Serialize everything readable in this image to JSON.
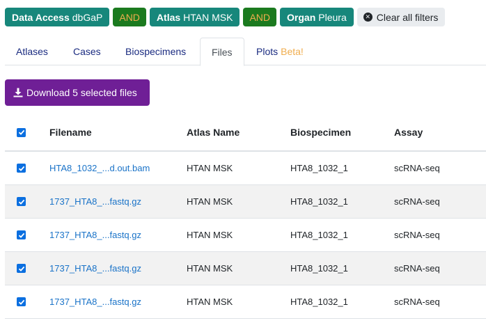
{
  "filters": [
    {
      "key": "Data Access",
      "value": "dbGaP"
    },
    {
      "key": "Atlas",
      "value": "HTAN MSK"
    },
    {
      "key": "Organ",
      "value": "Pleura"
    }
  ],
  "and_label": "AND",
  "clear_all_label": "Clear all filters",
  "tabs": [
    {
      "label": "Atlases"
    },
    {
      "label": "Cases"
    },
    {
      "label": "Biospecimens"
    },
    {
      "label": "Files",
      "active": true
    },
    {
      "label": "Plots",
      "badge": "Beta!"
    }
  ],
  "download_label": "Download 5 selected files",
  "table": {
    "headers": {
      "filename": "Filename",
      "atlas": "Atlas Name",
      "biospecimen": "Biospecimen",
      "assay": "Assay"
    },
    "rows": [
      {
        "checked": true,
        "filename": "HTA8_1032_...d.out.bam",
        "atlas": "HTAN MSK",
        "biospecimen": "HTA8_1032_1",
        "assay": "scRNA-seq"
      },
      {
        "checked": true,
        "filename": "1737_HTA8_...fastq.gz",
        "atlas": "HTAN MSK",
        "biospecimen": "HTA8_1032_1",
        "assay": "scRNA-seq"
      },
      {
        "checked": true,
        "filename": "1737_HTA8_...fastq.gz",
        "atlas": "HTAN MSK",
        "biospecimen": "HTA8_1032_1",
        "assay": "scRNA-seq"
      },
      {
        "checked": true,
        "filename": "1737_HTA8_...fastq.gz",
        "atlas": "HTAN MSK",
        "biospecimen": "HTA8_1032_1",
        "assay": "scRNA-seq"
      },
      {
        "checked": true,
        "filename": "1737_HTA8_...fastq.gz",
        "atlas": "HTAN MSK",
        "biospecimen": "HTA8_1032_1",
        "assay": "scRNA-seq"
      }
    ]
  },
  "colors": {
    "filter_pill": "#17877b",
    "and_pill": "#1b7a1f",
    "and_text": "#f0ad4e",
    "download_button": "#6f1f96",
    "link": "#1a73c8",
    "checkbox": "#0b6fe0"
  },
  "icons": {
    "clear": "close-circle-icon",
    "download": "download-icon",
    "checkbox": "checkbox-checked-icon"
  }
}
